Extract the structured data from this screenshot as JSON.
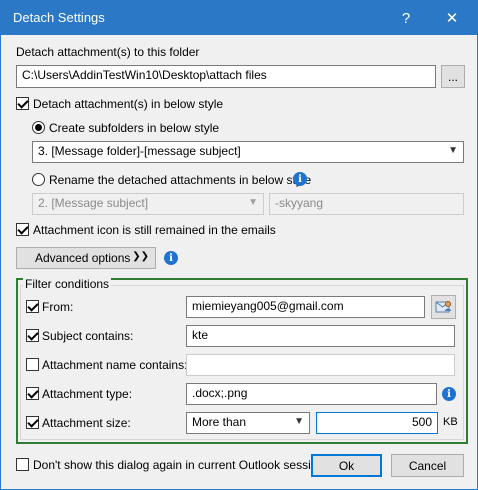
{
  "window": {
    "title": "Detach Settings",
    "help_glyph": "?",
    "close_glyph": "✕"
  },
  "folder": {
    "label": "Detach attachment(s) to this folder",
    "path": "C:\\Users\\AddinTestWin10\\Desktop\\attach files",
    "browse_label": "..."
  },
  "style": {
    "detach_checkbox_label": "Detach attachment(s) in below style",
    "detach_checked": true,
    "subfolder_radio_label": "Create subfolders in below style",
    "subfolder_selected": "3. [Message folder]-[message subject]",
    "rename_radio_label": "Rename the detached attachments in below style",
    "rename_selected": "2. [Message subject]",
    "rename_suffix": "-skyyang"
  },
  "icon_option": {
    "label": "Attachment icon is still remained in the emails",
    "checked": true
  },
  "advanced": {
    "label": "Advanced options",
    "chevron": "❯❯"
  },
  "filter": {
    "title": "Filter conditions",
    "from_label": "From:",
    "from_value": "miemieyang005@gmail.com",
    "subject_label": "Subject contains:",
    "subject_value": "kte",
    "name_label": "Attachment name contains:",
    "name_value": "",
    "type_label": "Attachment type:",
    "type_value": ".docx;.png",
    "size_label": "Attachment size:",
    "size_operator": "More than",
    "size_value": "500",
    "size_unit": "KB"
  },
  "footer": {
    "dont_show_label": "Don't show this dialog again in current Outlook session.",
    "ok_label": "Ok",
    "cancel_label": "Cancel"
  },
  "colors": {
    "titlebar": "#2b78c6",
    "filter_border": "#2e7d32",
    "info_icon": "#1e73d2"
  }
}
